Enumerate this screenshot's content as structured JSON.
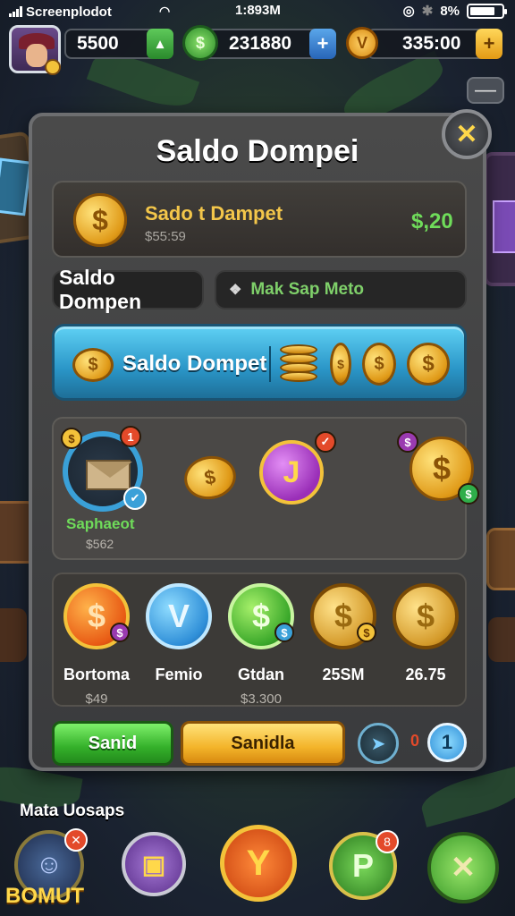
{
  "status_bar": {
    "carrier": "Screenplodot",
    "time": "1:893M",
    "battery_text": "8%",
    "battery_level": 0.8,
    "icons": [
      "signal-icon",
      "wifi-icon",
      "location-icon",
      "bluetooth-icon",
      "battery-icon"
    ]
  },
  "resources": {
    "gems": "5500",
    "cash": "231880",
    "coins": "335:00",
    "gems_button": "▴",
    "cash_button": "+",
    "coins_button": "+"
  },
  "panel": {
    "title": "Saldo Dompei",
    "close_label": "✕",
    "balance": {
      "label": "Sado t Dampet",
      "sub": "$55:59",
      "amount": "$,20"
    },
    "tabs": {
      "left": "Saldo Dompen",
      "right": "Mak Sap Meto"
    },
    "banner": {
      "label": "Saldo Dompet"
    },
    "grid1": {
      "name": "Saphaeot",
      "value": "$562",
      "badge1": "1"
    },
    "grid2": [
      {
        "name": "Bortoma",
        "sub": "$49"
      },
      {
        "name": "Femio",
        "sub": ""
      },
      {
        "name": "Gtdan",
        "sub": "$3.300"
      },
      {
        "name": "25SM",
        "sub": ""
      },
      {
        "name": "26.75",
        "sub": ""
      }
    ],
    "buttons": {
      "green": "Sanid",
      "yellow": "Sanidla",
      "count_zero": "0",
      "count_one": "1"
    }
  },
  "bottom": {
    "label": "Mata Uosaps",
    "brand": "BOMUT",
    "badges": {
      "profile": "✕",
      "shop": "8"
    }
  },
  "colors": {
    "accent_gold": "#f3c23a",
    "accent_green": "#6fdc5a",
    "panel_bg": "#3a3b3d",
    "banner_blue": "#2a95c7"
  }
}
